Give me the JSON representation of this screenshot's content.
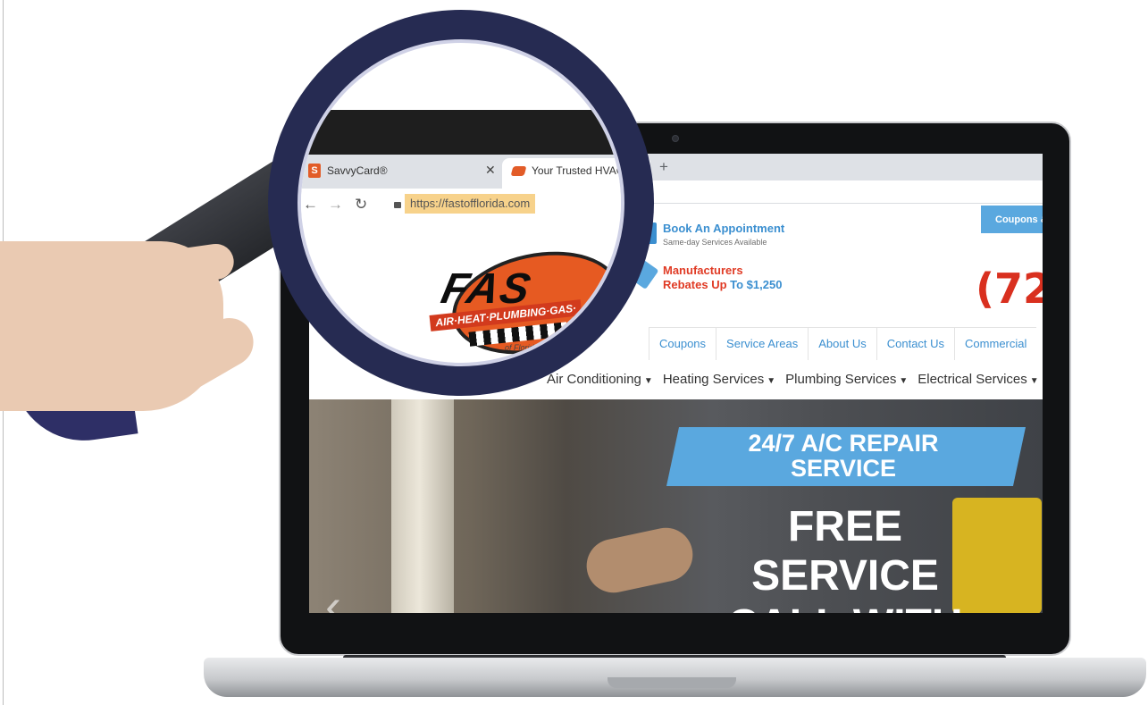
{
  "browser": {
    "tabs": [
      {
        "label": "SavvyCard®",
        "icon": "savvycard-icon"
      },
      {
        "label": "Your Trusted HVAC",
        "icon": "fast-favicon"
      }
    ],
    "new_tab_label": "+",
    "close_tab_label": "✕",
    "url": "https://fastofflorida.com",
    "nav_icons": [
      "back-arrow-icon",
      "forward-arrow-icon",
      "reload-icon",
      "lock-icon"
    ]
  },
  "site": {
    "logo": {
      "text": "FAS",
      "tagline": "AIR·HEAT·PLUMBING·GAS·",
      "subtext": "of Florida"
    },
    "coupons_tab": "Coupons &",
    "appointment": {
      "title": "Book An Appointment",
      "subtitle": "Same-day Services Available"
    },
    "rebates": {
      "line1": "Manufacturers",
      "line2_prefix": "Rebates Up",
      "line2_suffix": "To $1,250"
    },
    "phone_partial": "(72",
    "secondary_nav": [
      "Coupons",
      "Service Areas",
      "About Us",
      "Contact Us",
      "Commercial"
    ],
    "main_nav": [
      {
        "label": "Air Conditioning"
      },
      {
        "label": "Heating Services"
      },
      {
        "label": "Plumbing Services"
      },
      {
        "label": "Electrical Services"
      }
    ],
    "hero": {
      "banner_line1": "24/7 A/C REPAIR",
      "banner_line2": "SERVICE",
      "headline_line1": "FREE",
      "headline_line2": "SERVICE",
      "headline_line3": "CALL WITH",
      "prev_arrow": "‹"
    }
  },
  "colors": {
    "brand_blue": "#5aa8df",
    "brand_red": "#d9301f",
    "magnifier_ring": "#262b52",
    "url_highlight": "#f7d28b"
  }
}
